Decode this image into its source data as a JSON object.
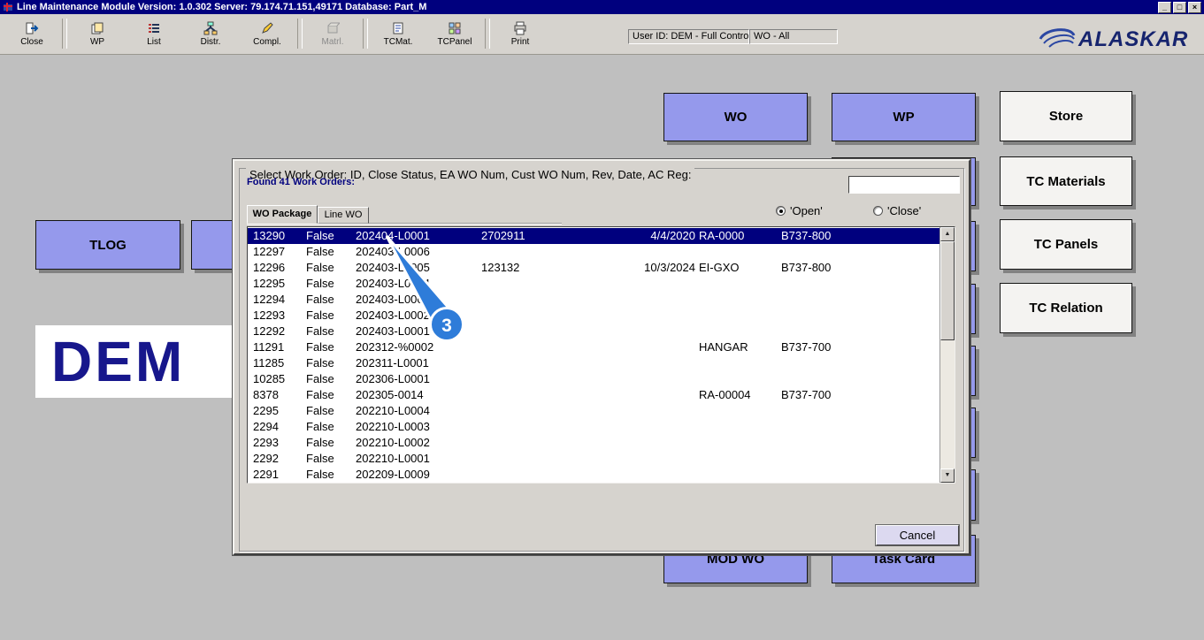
{
  "window": {
    "title": "Line Maintenance Module  Version: 1.0.302 Server: 79.174.71.151,49171 Database: Part_M"
  },
  "icons": {
    "minimize": "_",
    "restore": "□",
    "close": "×",
    "scroll_up": "▲",
    "scroll_down": "▼"
  },
  "toolbar": {
    "buttons": [
      {
        "label": "Close"
      },
      {
        "label": "WP"
      },
      {
        "label": "List"
      },
      {
        "label": "Distr."
      },
      {
        "label": "Compl."
      },
      {
        "label": "Matrl."
      },
      {
        "label": "TCMat."
      },
      {
        "label": "TCPanel"
      },
      {
        "label": "Print"
      }
    ],
    "user_box": "User ID: DEM - Full Control",
    "wo_box": "WO - All",
    "brand": "ALASKAR"
  },
  "main": {
    "buttons": {
      "wo": "WO",
      "wp": "WP",
      "store": "Store",
      "tc_materials": "TC Materials",
      "tc_panels": "TC Panels",
      "tc_relation": "TC Relation",
      "tlog": "TLOG",
      "mod_wo": "MOD WO",
      "task_card": "Task Card"
    },
    "dem_label": "DEM"
  },
  "dialog": {
    "title": "Select Work Order: ID, Close Status, EA WO Num, Cust WO Num, Rev, Date, AC Reg:",
    "found_label": "Found 41 Work Orders:",
    "search_value": "",
    "tabs": [
      "WO Package",
      "Line WO"
    ],
    "radio_open": "'Open'",
    "radio_close": "'Close'",
    "radio_selected": "open",
    "cancel_label": "Cancel",
    "selected_index": 0,
    "rows": [
      [
        "13290",
        "False",
        "202404-L0001",
        "2702911",
        "4/4/2020",
        "RA-0000",
        "B737-800"
      ],
      [
        "12297",
        "False",
        "202403-L0006",
        "",
        "",
        "",
        ""
      ],
      [
        "12296",
        "False",
        "202403-L0005",
        "123132",
        "10/3/2024",
        "EI-GXO",
        "B737-800"
      ],
      [
        "12295",
        "False",
        "202403-L0004",
        "",
        "",
        "",
        ""
      ],
      [
        "12294",
        "False",
        "202403-L0003",
        "",
        "",
        "",
        ""
      ],
      [
        "12293",
        "False",
        "202403-L0002",
        "",
        "",
        "",
        ""
      ],
      [
        "12292",
        "False",
        "202403-L0001",
        "",
        "",
        "",
        ""
      ],
      [
        "11291",
        "False",
        "202312-%0002",
        "",
        "",
        "HANGAR",
        "B737-700"
      ],
      [
        "11285",
        "False",
        "202311-L0001",
        "",
        "",
        "",
        ""
      ],
      [
        "10285",
        "False",
        "202306-L0001",
        "",
        "",
        "",
        ""
      ],
      [
        "8378",
        "False",
        "202305-0014",
        "",
        "",
        "RA-00004",
        "B737-700"
      ],
      [
        "2295",
        "False",
        "202210-L0004",
        "",
        "",
        "",
        ""
      ],
      [
        "2294",
        "False",
        "202210-L0003",
        "",
        "",
        "",
        ""
      ],
      [
        "2293",
        "False",
        "202210-L0002",
        "",
        "",
        "",
        ""
      ],
      [
        "2292",
        "False",
        "202210-L0001",
        "",
        "",
        "",
        ""
      ],
      [
        "2291",
        "False",
        "202209-L0009",
        "",
        "",
        "",
        ""
      ]
    ]
  },
  "annotation": {
    "step": "3"
  }
}
